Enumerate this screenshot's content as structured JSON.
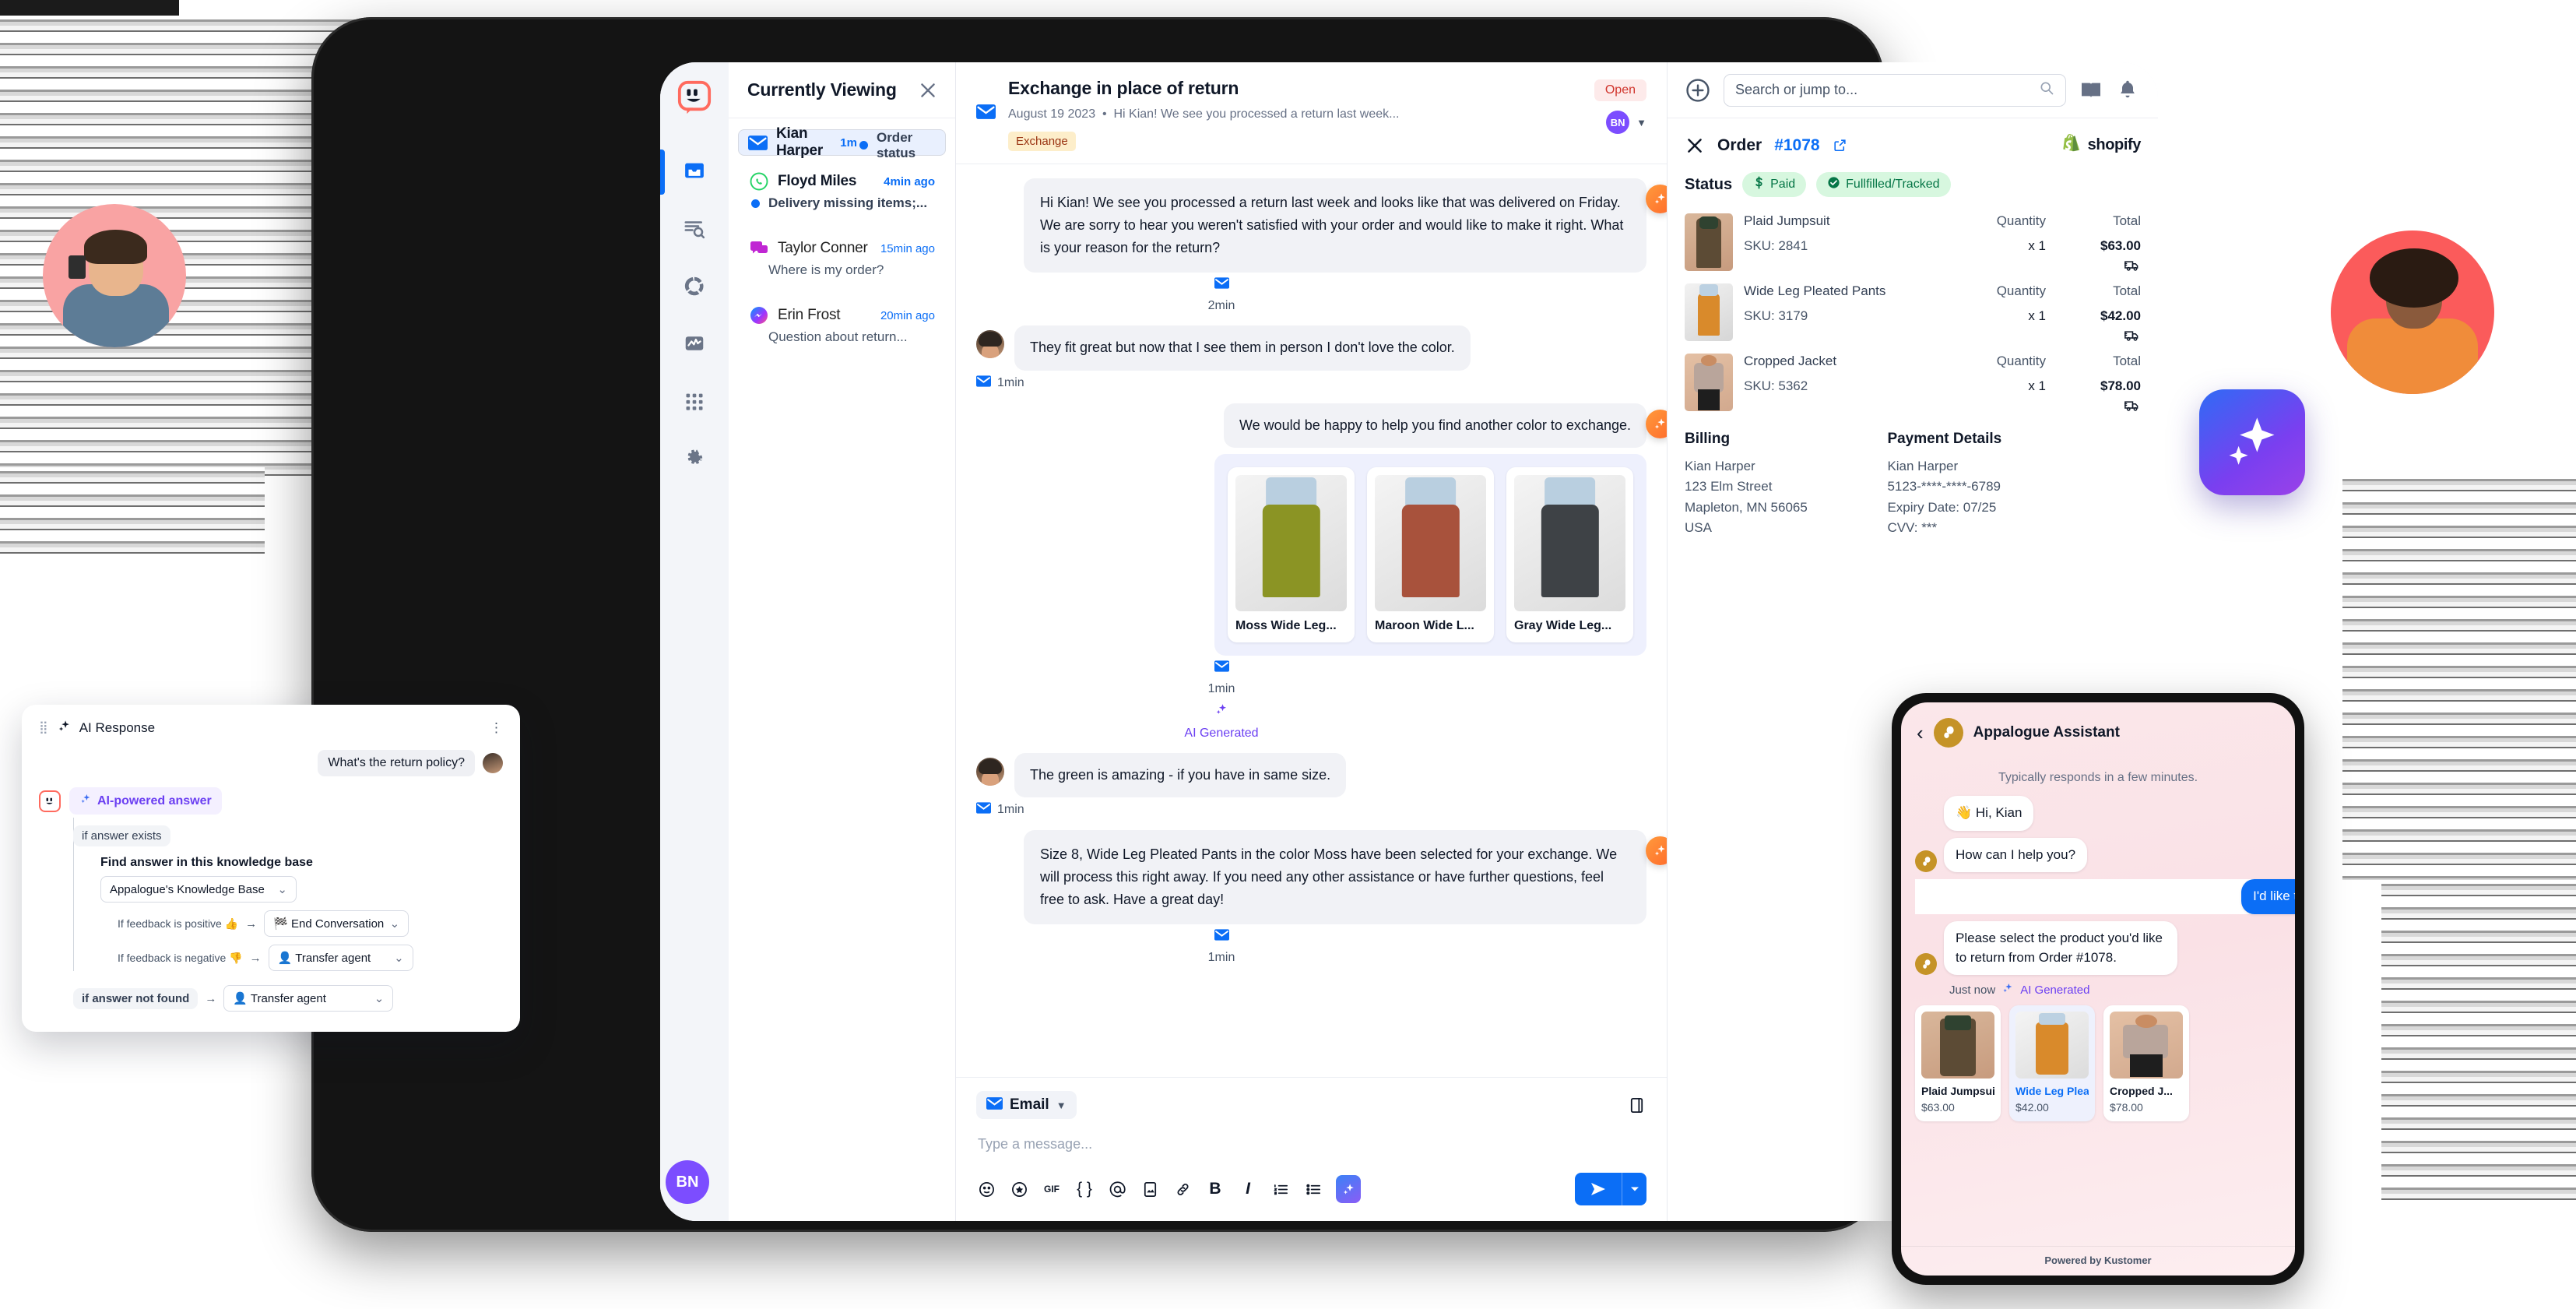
{
  "sidebar": {
    "logo": "kustomer-logo",
    "items": [
      {
        "name": "inbox",
        "icon": "inbox-icon",
        "active": true
      },
      {
        "name": "search",
        "icon": "search-list-icon",
        "active": false
      },
      {
        "name": "insights",
        "icon": "donut-chart-icon",
        "active": false
      },
      {
        "name": "reporting",
        "icon": "analytics-icon",
        "active": false
      },
      {
        "name": "apps",
        "icon": "grid-apps-icon",
        "active": false
      },
      {
        "name": "settings",
        "icon": "gear-icon",
        "active": false
      }
    ],
    "avatar_initials": "BN"
  },
  "conversation_list": {
    "title": "Currently Viewing",
    "close_label": "×",
    "items": [
      {
        "name": "Kian Harper",
        "preview": "Order status",
        "time": "1m",
        "channel": "email",
        "selected": true,
        "unread": true
      },
      {
        "name": "Floyd Miles",
        "preview": "Delivery missing items;...",
        "time": "4min ago",
        "channel": "whatsapp",
        "selected": false,
        "unread": true
      },
      {
        "name": "Taylor Conner",
        "preview": "Where is my order?",
        "time": "15min ago",
        "channel": "chat",
        "selected": false,
        "unread": false
      },
      {
        "name": "Erin Frost",
        "preview": "Question about return...",
        "time": "20min ago",
        "channel": "messenger",
        "selected": false,
        "unread": false
      }
    ]
  },
  "conversation": {
    "title": "Exchange in place of return",
    "date": "August 19 2023",
    "preview": "Hi Kian! We see you processed a return last week...",
    "tag": "Exchange",
    "status_badge": "Open",
    "assignee_initials": "BN",
    "messages": [
      {
        "direction": "out",
        "text": "Hi Kian! We see you processed a return last week and looks like that was delivered on Friday. We are sorry to hear you weren't satisfied with your order and would like to make it right. What is your reason for the return?",
        "time": "2min",
        "channel_icon": "email-icon",
        "ai_generated": false
      },
      {
        "direction": "in",
        "text": "They fit great but now that I see them in person I don't love the color.",
        "time": "1min",
        "channel_icon": "email-icon",
        "ai_generated": false
      },
      {
        "direction": "out",
        "text": "We would be happy to help you find another color to exchange.",
        "time": "1min",
        "channel_icon": "email-icon",
        "ai_generated": true,
        "ai_label": "AI Generated"
      },
      {
        "direction": "in",
        "text": "The green is amazing - if you have in same size.",
        "time": "1min",
        "channel_icon": "email-icon",
        "ai_generated": false
      },
      {
        "direction": "out",
        "text": "Size 8, Wide Leg Pleated Pants in the color Moss have been selected for your exchange. We will process this right away. If you need any other assistance or have further questions, feel free to ask. Have a great day!",
        "time": "1min",
        "channel_icon": "email-icon",
        "ai_generated": false
      }
    ],
    "product_suggestions": [
      {
        "name": "Moss Wide Leg...",
        "color": "#8b9424"
      },
      {
        "name": "Maroon Wide L...",
        "color": "#a8523c"
      },
      {
        "name": "Gray Wide Leg...",
        "color": "#3e4246"
      }
    ]
  },
  "composer": {
    "channel": "Email",
    "placeholder": "Type a message...",
    "tools": [
      {
        "name": "emoji-icon",
        "glyph": "☺"
      },
      {
        "name": "sticker-icon",
        "glyph": "★"
      },
      {
        "name": "gif-icon",
        "glyph": "GIF"
      },
      {
        "name": "snippet-icon",
        "glyph": "{ }"
      },
      {
        "name": "mention-icon",
        "glyph": "@"
      },
      {
        "name": "image-icon",
        "glyph": "▣"
      },
      {
        "name": "attachment-icon",
        "glyph": "🔗"
      },
      {
        "name": "bold-icon",
        "glyph": "B"
      },
      {
        "name": "italic-icon",
        "glyph": "I"
      },
      {
        "name": "ordered-list-icon",
        "glyph": "≔"
      },
      {
        "name": "bullet-list-icon",
        "glyph": "≡"
      },
      {
        "name": "ai-assist-icon",
        "glyph": "✦"
      }
    ],
    "send_label": "Send",
    "note_icon": "note-icon"
  },
  "top_bar": {
    "add_label": "+",
    "search_placeholder": "Search or jump to...",
    "icons": [
      "knowledge-book-icon",
      "notifications-bell-icon"
    ]
  },
  "order_panel": {
    "close_label": "×",
    "order_label": "Order",
    "order_number": "#1078",
    "platform": "shopify",
    "status_label": "Status",
    "status_chips": [
      {
        "label": "Paid",
        "icon": "dollar-icon"
      },
      {
        "label": "Fullfilled/Tracked",
        "icon": "check-circle-icon"
      }
    ],
    "col_quantity": "Quantity",
    "col_total": "Total",
    "items": [
      {
        "name": "Plaid Jumpsuit",
        "sku": "SKU: 2841",
        "qty": "x 1",
        "total": "$63.00",
        "color": "#5c4b35"
      },
      {
        "name": "Wide Leg Pleated Pants",
        "sku": "SKU: 3179",
        "qty": "x 1",
        "total": "$42.00",
        "color": "#d98a2b"
      },
      {
        "name": "Cropped Jacket",
        "sku": "SKU: 5362",
        "qty": "x 1",
        "total": "$78.00",
        "color": "#b9a59b"
      }
    ],
    "billing": {
      "heading": "Billing",
      "name": "Kian Harper",
      "street": "123 Elm Street",
      "city": "Mapleton, MN 56065",
      "country": "USA"
    },
    "payment": {
      "heading": "Payment Details",
      "name": "Kian Harper",
      "card": "5123-****-****-6789",
      "expiry": "Expiry Date: 07/25",
      "cvv": "CVV: ***"
    }
  },
  "ai_response_card": {
    "title": "AI Response",
    "menu_icon": "kebab-menu-icon",
    "question": "What's the return policy?",
    "answer_pill": "AI-powered answer",
    "branch_exists": "if answer exists",
    "kb_label": "Find answer in this knowledge base",
    "kb_value": "Appalogue's Knowledge Base",
    "positive_label": "If feedback is positive 👍",
    "positive_value": "🏁 End Conversation",
    "negative_label": "If feedback is negative 👎",
    "negative_value": "👤 Transfer agent",
    "not_found_label": "if answer not found",
    "not_found_value": "👤 Transfer agent"
  },
  "assistant_widget": {
    "back_icon": "chevron-left-icon",
    "title": "Appalogue Assistant",
    "subtitle": "Typically responds in a few minutes.",
    "messages": [
      {
        "from": "bot",
        "text": "👋 Hi, Kian"
      },
      {
        "from": "bot",
        "text": "How can I help you?"
      },
      {
        "from": "user",
        "text": "I'd like to make a return."
      },
      {
        "from": "bot",
        "text": "Please select the product you'd like to return from Order #1078."
      }
    ],
    "meta_time": "Just now",
    "meta_ai": "AI Generated",
    "products": [
      {
        "name": "Plaid Jumpsuit...",
        "price": "$63.00",
        "selected": false,
        "color": "#5c4b35"
      },
      {
        "name": "Wide Leg Pleat...",
        "price": "$42.00",
        "selected": true,
        "color": "#d98a2b"
      },
      {
        "name": "Cropped J...",
        "price": "$78.00",
        "selected": false,
        "color": "#b9a59b"
      }
    ],
    "footer": "Powered by Kustomer"
  }
}
